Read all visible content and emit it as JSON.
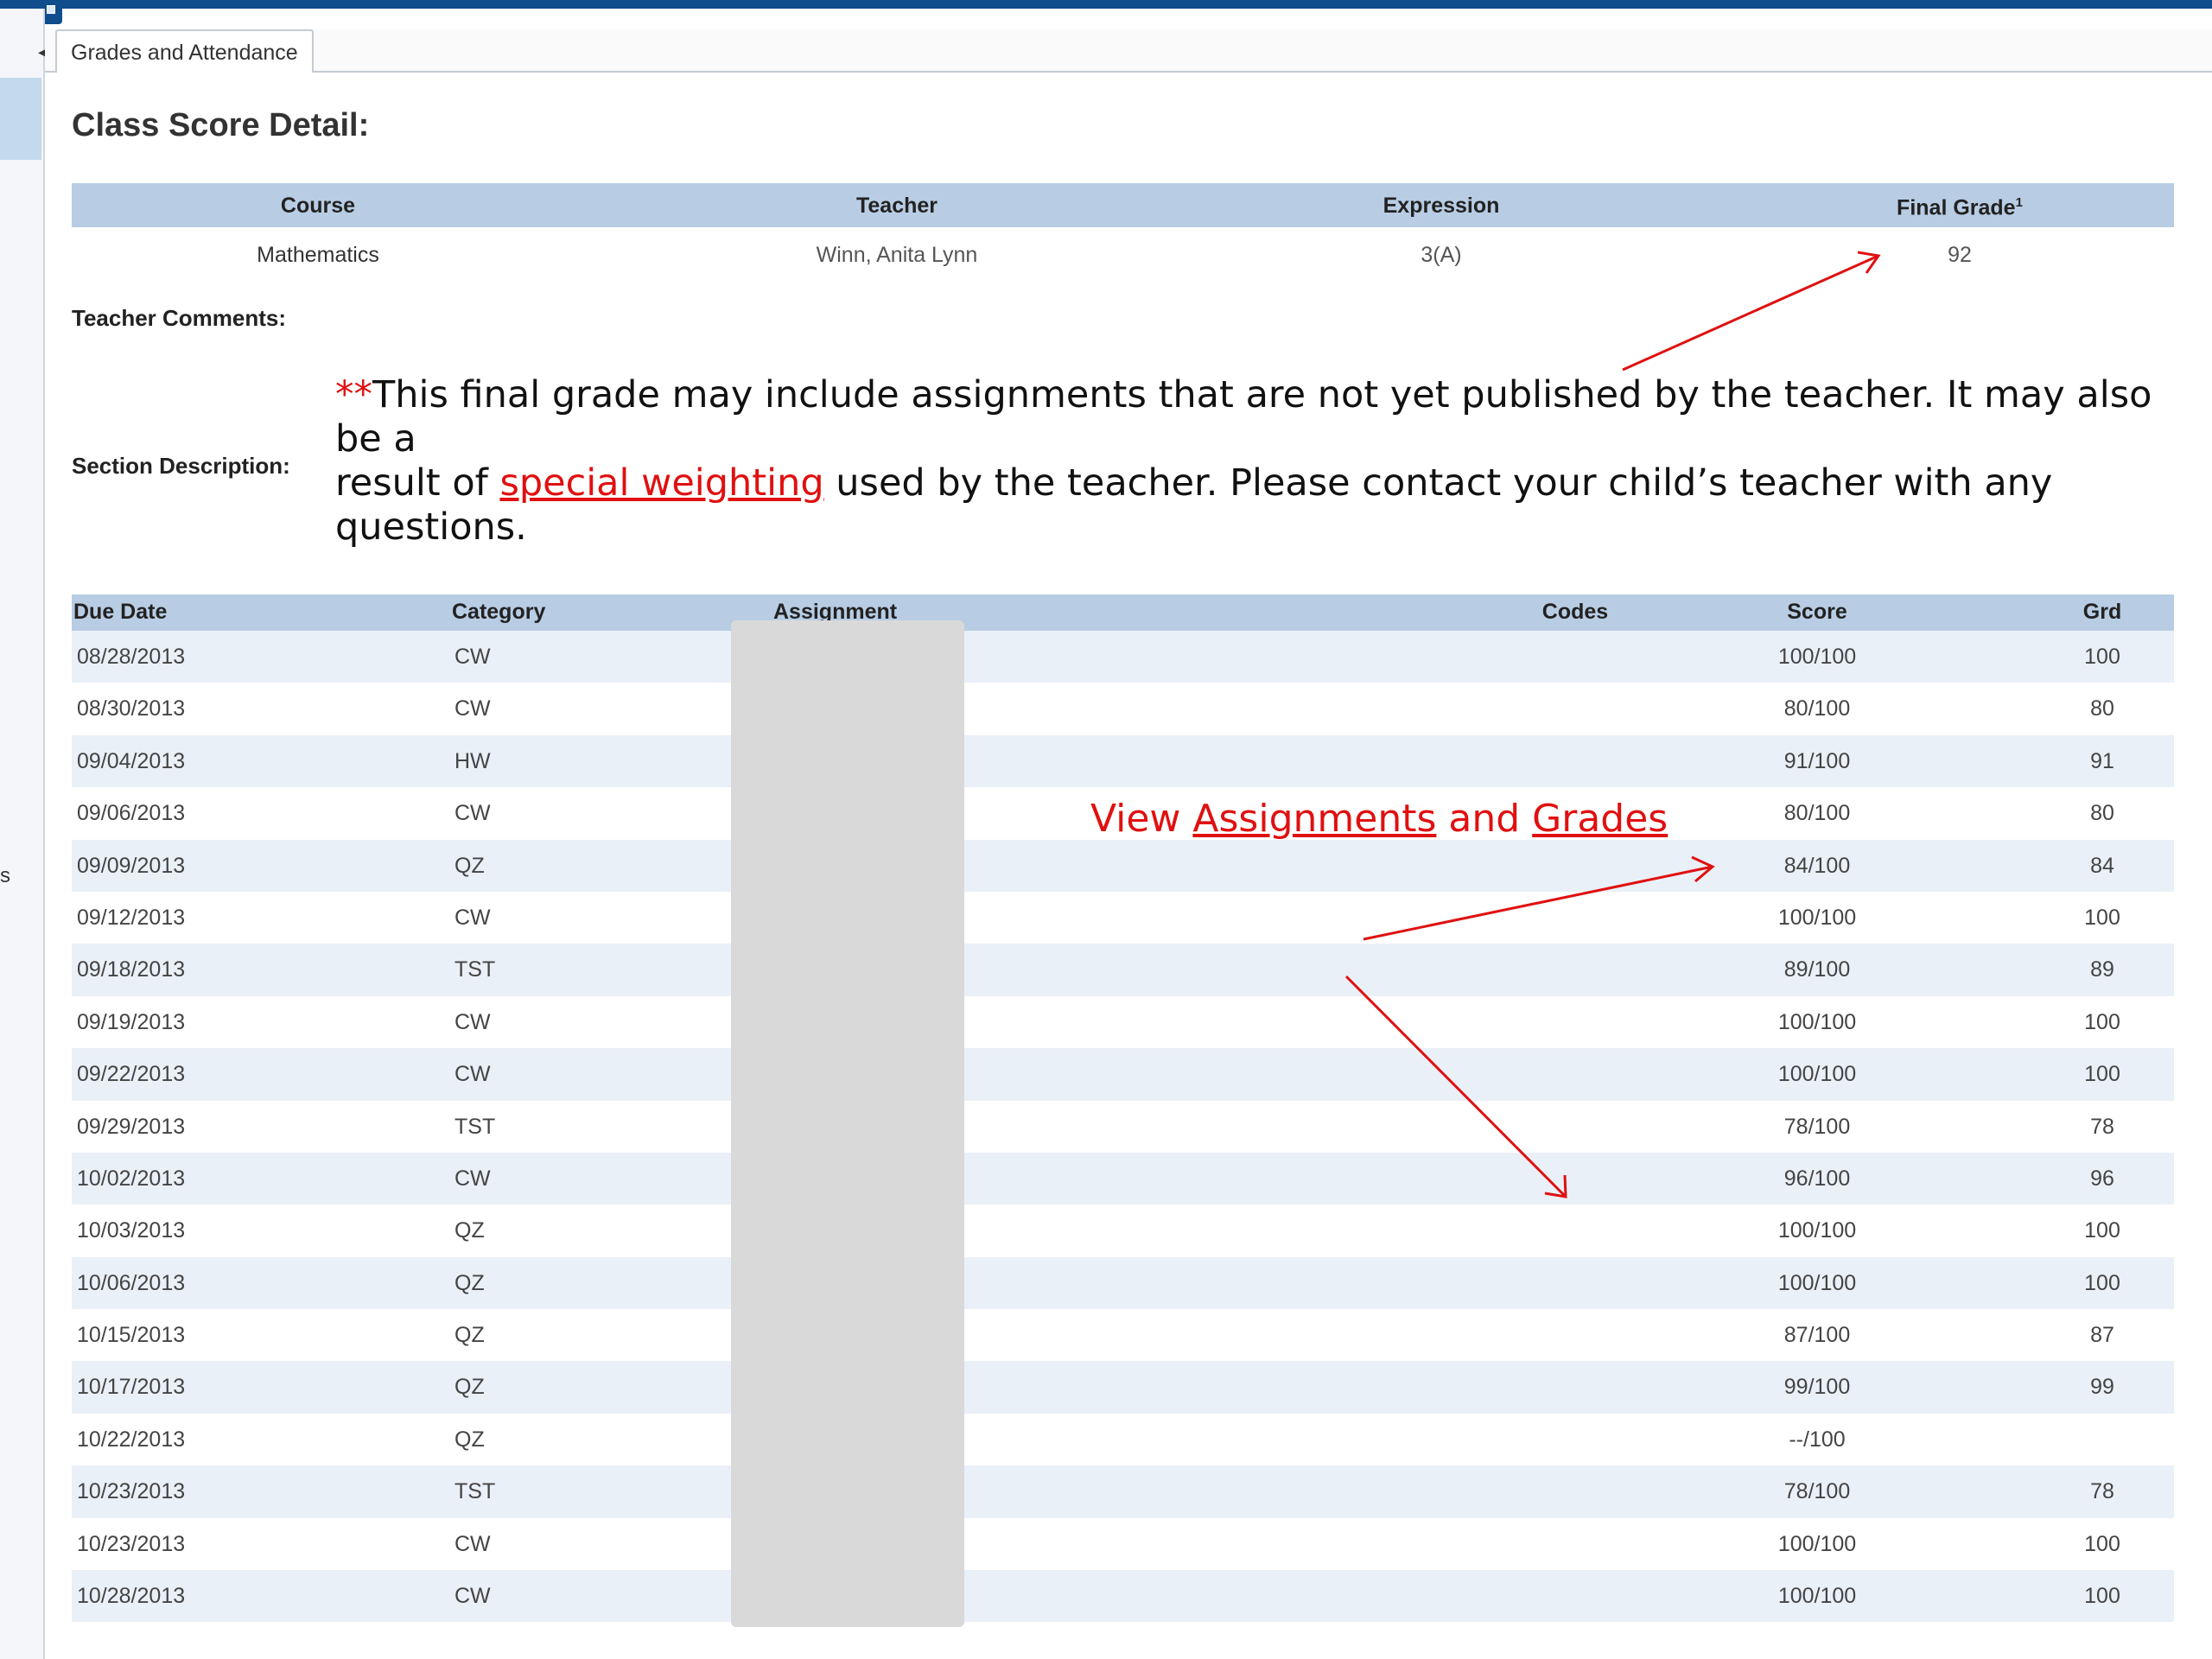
{
  "tab": {
    "label": "Grades and Attendance"
  },
  "left": {
    "partial_text": "s"
  },
  "page": {
    "title": "Class Score Detail:"
  },
  "course_table": {
    "headers": {
      "course": "Course",
      "teacher": "Teacher",
      "expression": "Expression",
      "final_grade": "Final Grade",
      "final_grade_sup": "1"
    },
    "row": {
      "course": "Mathematics",
      "teacher": "Winn, Anita Lynn",
      "expression": "3(A)",
      "final_grade": "92"
    }
  },
  "labels": {
    "teacher_comments": "Teacher Comments:",
    "section_description": "Section Description:"
  },
  "note": {
    "stars": "**",
    "line1": "This final grade may include assignments that are not yet published by the teacher. It may also be a",
    "line2_pre": "result of ",
    "link": "special weighting",
    "line2_post": " used by the teacher.  Please contact your child’s teacher with any questions."
  },
  "annotation": {
    "pre": "View ",
    "w1": "Assignments",
    "mid": " and ",
    "w2": "Grades"
  },
  "scores": {
    "headers": {
      "due_date": "Due Date",
      "category": "Category",
      "assignment": "Assignment",
      "codes": "Codes",
      "score": "Score",
      "grd": "Grd"
    },
    "rows": [
      {
        "date": "08/28/2013",
        "cat": "CW",
        "score": "100/100",
        "grd": "100"
      },
      {
        "date": "08/30/2013",
        "cat": "CW",
        "score": "80/100",
        "grd": "80"
      },
      {
        "date": "09/04/2013",
        "cat": "HW",
        "score": "91/100",
        "grd": "91"
      },
      {
        "date": "09/06/2013",
        "cat": "CW",
        "score": "80/100",
        "grd": "80"
      },
      {
        "date": "09/09/2013",
        "cat": "QZ",
        "score": "84/100",
        "grd": "84"
      },
      {
        "date": "09/12/2013",
        "cat": "CW",
        "score": "100/100",
        "grd": "100"
      },
      {
        "date": "09/18/2013",
        "cat": "TST",
        "score": "89/100",
        "grd": "89"
      },
      {
        "date": "09/19/2013",
        "cat": "CW",
        "score": "100/100",
        "grd": "100"
      },
      {
        "date": "09/22/2013",
        "cat": "CW",
        "score": "100/100",
        "grd": "100"
      },
      {
        "date": "09/29/2013",
        "cat": "TST",
        "score": "78/100",
        "grd": "78"
      },
      {
        "date": "10/02/2013",
        "cat": "CW",
        "score": "96/100",
        "grd": "96"
      },
      {
        "date": "10/03/2013",
        "cat": "QZ",
        "score": "100/100",
        "grd": "100"
      },
      {
        "date": "10/06/2013",
        "cat": "QZ",
        "score": "100/100",
        "grd": "100"
      },
      {
        "date": "10/15/2013",
        "cat": "QZ",
        "score": "87/100",
        "grd": "87"
      },
      {
        "date": "10/17/2013",
        "cat": "QZ",
        "score": "99/100",
        "grd": "99"
      },
      {
        "date": "10/22/2013",
        "cat": "QZ",
        "score": "--/100",
        "grd": ""
      },
      {
        "date": "10/23/2013",
        "cat": "TST",
        "score": "78/100",
        "grd": "78"
      },
      {
        "date": "10/23/2013",
        "cat": "CW",
        "score": "100/100",
        "grd": "100"
      },
      {
        "date": "10/28/2013",
        "cat": "CW",
        "score": "100/100",
        "grd": "100"
      }
    ]
  },
  "colors": {
    "header_bg": "#b8cde4",
    "row_alt": "#eaf0f8",
    "annotation_red": "#e01010",
    "topbar": "#0f4d8d"
  }
}
